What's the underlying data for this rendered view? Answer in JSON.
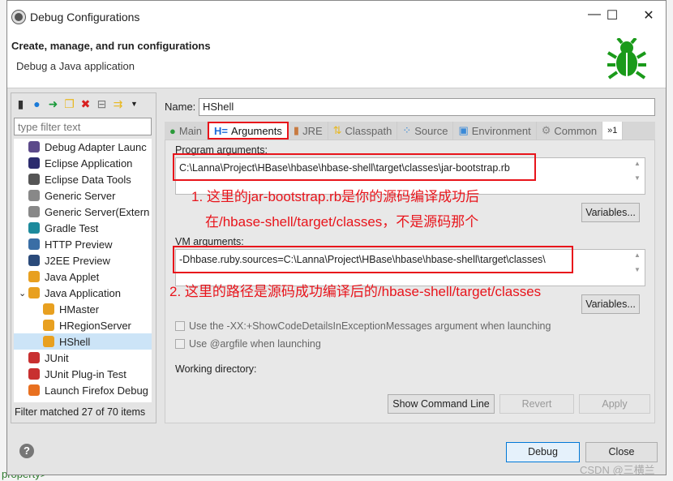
{
  "window": {
    "title": "Debug Configurations",
    "minimize": "—",
    "maximize": "☐",
    "close": "✕"
  },
  "header": {
    "title": "Create, manage, and run configurations",
    "subtitle": "Debug a Java application"
  },
  "left": {
    "filter_placeholder": "type filter text",
    "items": [
      {
        "label": "Debug Adapter Launc",
        "color": "#5c4a8a",
        "indent": 0
      },
      {
        "label": "Eclipse Application",
        "color": "#2c2c6e",
        "indent": 0
      },
      {
        "label": "Eclipse Data Tools",
        "color": "#555555",
        "indent": 0
      },
      {
        "label": "Generic Server",
        "color": "#888888",
        "indent": 0
      },
      {
        "label": "Generic Server(Extern",
        "color": "#888888",
        "indent": 0
      },
      {
        "label": "Gradle Test",
        "color": "#1c8a9c",
        "indent": 0
      },
      {
        "label": "HTTP Preview",
        "color": "#3a6ea5",
        "indent": 0
      },
      {
        "label": "J2EE Preview",
        "color": "#2a4a7a",
        "indent": 0
      },
      {
        "label": "Java Applet",
        "color": "#e8a020",
        "indent": 0
      },
      {
        "label": "Java Application",
        "color": "#e8a020",
        "indent": 0,
        "expanded": true
      },
      {
        "label": "HMaster",
        "color": "#e8a020",
        "indent": 1
      },
      {
        "label": "HRegionServer",
        "color": "#e8a020",
        "indent": 1
      },
      {
        "label": "HShell",
        "color": "#e8a020",
        "indent": 1,
        "selected": true
      },
      {
        "label": "JUnit",
        "color": "#c83030",
        "indent": 0
      },
      {
        "label": "JUnit Plug-in Test",
        "color": "#c83030",
        "indent": 0
      },
      {
        "label": "Launch Firefox Debug",
        "color": "#e87020",
        "indent": 0
      }
    ],
    "status": "Filter matched 27 of 70 items"
  },
  "right": {
    "name_label": "Name:",
    "name_value": "HShell",
    "tabs": [
      "Main",
      "Arguments",
      "JRE",
      "Classpath",
      "Source",
      "Environment",
      "Common",
      "»1"
    ],
    "active_tab": "Arguments",
    "program_args_label": "Program arguments:",
    "program_args": "C:\\Lanna\\Project\\HBase\\hbase\\hbase-shell\\target\\classes\\jar-bootstrap.rb",
    "variables": "Variables...",
    "vm_args_label": "VM arguments:",
    "vm_args": "-Dhbase.ruby.sources=C:\\Lanna\\Project\\HBase\\hbase\\hbase-shell\\target\\classes\\",
    "note1_line1": "1. 这里的jar-bootstrap.rb是你的源码编译成功后",
    "note1_line2": "在/hbase-shell/target/classes，不是源码那个",
    "note2": "2. 这里的路径是源码成功编译后的/hbase-shell/target/classes",
    "check1": "Use the -XX:+ShowCodeDetailsInExceptionMessages argument when launching",
    "check2": "Use @argfile when launching",
    "workdir_label": "Working directory:",
    "show_cmd": "Show Command Line",
    "revert": "Revert",
    "apply": "Apply"
  },
  "footer": {
    "debug": "Debug",
    "close": "Close",
    "help": "?"
  },
  "watermark": "CSDN @三横兰",
  "background_text": "property>"
}
